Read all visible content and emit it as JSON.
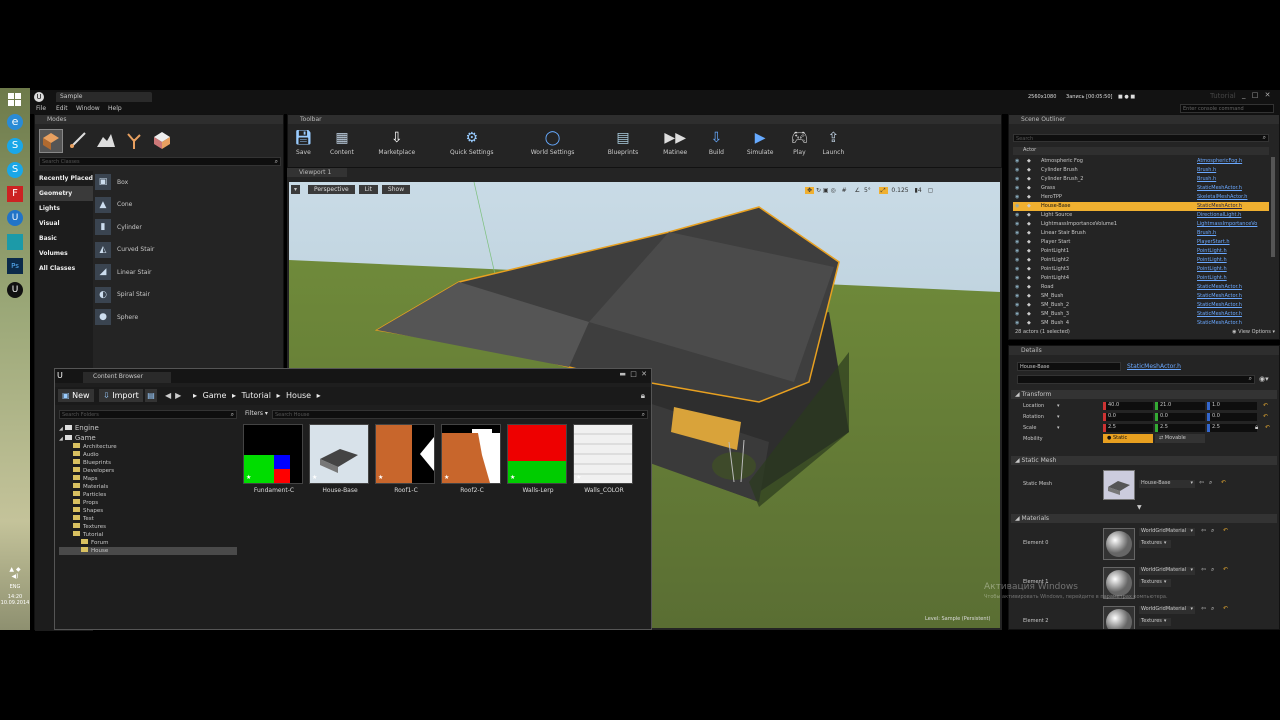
{
  "taskbar": {
    "apps": [
      "windows-logo",
      "ie-browser",
      "skype",
      "skype-2",
      "filezilla",
      "unreal-engine",
      "green-app",
      "photoshop",
      "unreal-launcher"
    ],
    "tray": {
      "lang": "ENG",
      "time": "14:20",
      "date": "10.09.2014"
    }
  },
  "window": {
    "title": "Sample",
    "menu": [
      "File",
      "Edit",
      "Window",
      "Help"
    ],
    "recording": {
      "resolution": "2560x1080",
      "status": "Запись [00:05:50]"
    },
    "brand": "Tutorial",
    "console_placeholder": "Enter console command"
  },
  "modes": {
    "tab": "Modes",
    "search_placeholder": "Search Classes",
    "categories": [
      "Recently Placed",
      "Geometry",
      "Lights",
      "Visual",
      "Basic",
      "Volumes",
      "All Classes"
    ],
    "selected_category": "Geometry",
    "items": [
      "Box",
      "Cone",
      "Cylinder",
      "Curved Stair",
      "Linear Stair",
      "Spiral Stair",
      "Sphere"
    ]
  },
  "toolbar": {
    "tab": "Toolbar",
    "buttons": [
      "Save",
      "Content",
      "Marketplace",
      "Quick Settings",
      "World Settings",
      "Blueprints",
      "Matinee",
      "Build",
      "Simulate",
      "Play",
      "Launch"
    ]
  },
  "viewport": {
    "tab": "Viewport 1",
    "perspective": "Perspective",
    "lit": "Lit",
    "show": "Show",
    "fov": "0.125",
    "snap_angle": "5°",
    "level": "Level: Sample (Persistent)"
  },
  "content_browser": {
    "title": "Content Browser",
    "new": "New",
    "import": "Import",
    "path": [
      "Game",
      "Tutorial",
      "House"
    ],
    "search_folders": "Search Folders",
    "filters": "Filters",
    "search_assets": "Search House",
    "tree": [
      {
        "label": "Engine",
        "level": 0
      },
      {
        "label": "Game",
        "level": 0
      },
      {
        "label": "Architecture",
        "level": 1
      },
      {
        "label": "Audio",
        "level": 1
      },
      {
        "label": "Blueprints",
        "level": 1
      },
      {
        "label": "Developers",
        "level": 1
      },
      {
        "label": "Maps",
        "level": 1
      },
      {
        "label": "Materials",
        "level": 1
      },
      {
        "label": "Particles",
        "level": 1
      },
      {
        "label": "Props",
        "level": 1
      },
      {
        "label": "Shapes",
        "level": 1
      },
      {
        "label": "Test",
        "level": 1
      },
      {
        "label": "Textures",
        "level": 1
      },
      {
        "label": "Tutorial",
        "level": 1
      },
      {
        "label": "Forum",
        "level": 2
      },
      {
        "label": "House",
        "level": 2
      }
    ],
    "assets": [
      "Fundament-C",
      "House-Base",
      "Roof1-C",
      "Roof2-C",
      "Walls-Lerp",
      "Walls_COLOR"
    ]
  },
  "outliner": {
    "tab": "Scene Outliner",
    "search_placeholder": "Search",
    "column": "Actor",
    "rows": [
      {
        "name": "Atmospheric Fog",
        "type": "AtmosphericFog.h"
      },
      {
        "name": "Cylinder Brush",
        "type": "Brush.h"
      },
      {
        "name": "Cylinder Brush_2",
        "type": "Brush.h"
      },
      {
        "name": "Grass",
        "type": "StaticMeshActor.h"
      },
      {
        "name": "HeroTPP",
        "type": "SkeletalMeshActor.h"
      },
      {
        "name": "House-Base",
        "type": "StaticMeshActor.h"
      },
      {
        "name": "Light Source",
        "type": "DirectionalLight.h"
      },
      {
        "name": "LightmassImportanceVolume1",
        "type": "LightmassImportanceVo"
      },
      {
        "name": "Linear Stair Brush",
        "type": "Brush.h"
      },
      {
        "name": "Player Start",
        "type": "PlayerStart.h"
      },
      {
        "name": "PointLight1",
        "type": "PointLight.h"
      },
      {
        "name": "PointLight2",
        "type": "PointLight.h"
      },
      {
        "name": "PointLight3",
        "type": "PointLight.h"
      },
      {
        "name": "PointLight4",
        "type": "PointLight.h"
      },
      {
        "name": "Road",
        "type": "StaticMeshActor.h"
      },
      {
        "name": "SM_Bush",
        "type": "StaticMeshActor.h"
      },
      {
        "name": "SM_Bush_2",
        "type": "StaticMeshActor.h"
      },
      {
        "name": "SM_Bush_3",
        "type": "StaticMeshActor.h"
      },
      {
        "name": "SM_Bush_4",
        "type": "StaticMeshActor.h"
      }
    ],
    "selected": "House-Base",
    "footer": "28 actors (1 selected)",
    "view_options": "View Options"
  },
  "details": {
    "tab": "Details",
    "name": "House-Base",
    "class_link": "StaticMeshActor.h",
    "transform_title": "Transform",
    "location": {
      "label": "Location",
      "x": "40.0",
      "y": "21.0",
      "z": "1.0"
    },
    "rotation": {
      "label": "Rotation",
      "x": "0.0",
      "y": "0.0",
      "z": "0.0"
    },
    "scale": {
      "label": "Scale",
      "x": "2.5",
      "y": "2.5",
      "z": "2.5"
    },
    "mobility": {
      "label": "Mobility",
      "static": "Static",
      "movable": "Movable"
    },
    "static_mesh_title": "Static Mesh",
    "static_mesh_label": "Static Mesh",
    "static_mesh_value": "House-Base",
    "materials_title": "Materials",
    "elements": [
      {
        "label": "Element 0",
        "material": "WorldGridMaterial",
        "sub": "Textures"
      },
      {
        "label": "Element 1",
        "material": "WorldGridMaterial",
        "sub": "Textures"
      },
      {
        "label": "Element 2",
        "material": "WorldGridMaterial",
        "sub": "Textures"
      }
    ]
  },
  "watermark": {
    "line1": "Активация Windows",
    "line2": "Чтобы активировать Windows, перейдите в параметрах компьютера."
  }
}
